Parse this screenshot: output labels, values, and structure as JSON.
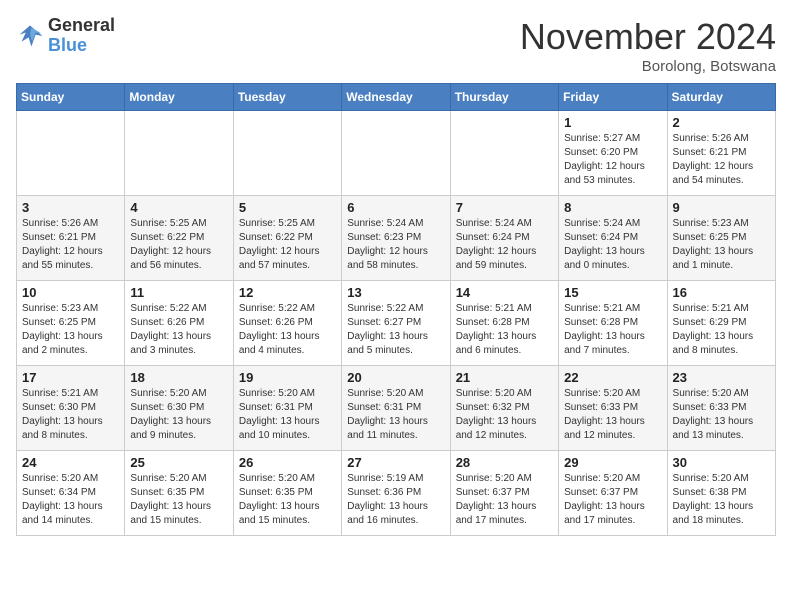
{
  "header": {
    "logo_general": "General",
    "logo_blue": "Blue",
    "month_title": "November 2024",
    "location": "Borolong, Botswana"
  },
  "weekdays": [
    "Sunday",
    "Monday",
    "Tuesday",
    "Wednesday",
    "Thursday",
    "Friday",
    "Saturday"
  ],
  "weeks": [
    [
      {
        "day": "",
        "detail": ""
      },
      {
        "day": "",
        "detail": ""
      },
      {
        "day": "",
        "detail": ""
      },
      {
        "day": "",
        "detail": ""
      },
      {
        "day": "",
        "detail": ""
      },
      {
        "day": "1",
        "detail": "Sunrise: 5:27 AM\nSunset: 6:20 PM\nDaylight: 12 hours\nand 53 minutes."
      },
      {
        "day": "2",
        "detail": "Sunrise: 5:26 AM\nSunset: 6:21 PM\nDaylight: 12 hours\nand 54 minutes."
      }
    ],
    [
      {
        "day": "3",
        "detail": "Sunrise: 5:26 AM\nSunset: 6:21 PM\nDaylight: 12 hours\nand 55 minutes."
      },
      {
        "day": "4",
        "detail": "Sunrise: 5:25 AM\nSunset: 6:22 PM\nDaylight: 12 hours\nand 56 minutes."
      },
      {
        "day": "5",
        "detail": "Sunrise: 5:25 AM\nSunset: 6:22 PM\nDaylight: 12 hours\nand 57 minutes."
      },
      {
        "day": "6",
        "detail": "Sunrise: 5:24 AM\nSunset: 6:23 PM\nDaylight: 12 hours\nand 58 minutes."
      },
      {
        "day": "7",
        "detail": "Sunrise: 5:24 AM\nSunset: 6:24 PM\nDaylight: 12 hours\nand 59 minutes."
      },
      {
        "day": "8",
        "detail": "Sunrise: 5:24 AM\nSunset: 6:24 PM\nDaylight: 13 hours\nand 0 minutes."
      },
      {
        "day": "9",
        "detail": "Sunrise: 5:23 AM\nSunset: 6:25 PM\nDaylight: 13 hours\nand 1 minute."
      }
    ],
    [
      {
        "day": "10",
        "detail": "Sunrise: 5:23 AM\nSunset: 6:25 PM\nDaylight: 13 hours\nand 2 minutes."
      },
      {
        "day": "11",
        "detail": "Sunrise: 5:22 AM\nSunset: 6:26 PM\nDaylight: 13 hours\nand 3 minutes."
      },
      {
        "day": "12",
        "detail": "Sunrise: 5:22 AM\nSunset: 6:26 PM\nDaylight: 13 hours\nand 4 minutes."
      },
      {
        "day": "13",
        "detail": "Sunrise: 5:22 AM\nSunset: 6:27 PM\nDaylight: 13 hours\nand 5 minutes."
      },
      {
        "day": "14",
        "detail": "Sunrise: 5:21 AM\nSunset: 6:28 PM\nDaylight: 13 hours\nand 6 minutes."
      },
      {
        "day": "15",
        "detail": "Sunrise: 5:21 AM\nSunset: 6:28 PM\nDaylight: 13 hours\nand 7 minutes."
      },
      {
        "day": "16",
        "detail": "Sunrise: 5:21 AM\nSunset: 6:29 PM\nDaylight: 13 hours\nand 8 minutes."
      }
    ],
    [
      {
        "day": "17",
        "detail": "Sunrise: 5:21 AM\nSunset: 6:30 PM\nDaylight: 13 hours\nand 8 minutes."
      },
      {
        "day": "18",
        "detail": "Sunrise: 5:20 AM\nSunset: 6:30 PM\nDaylight: 13 hours\nand 9 minutes."
      },
      {
        "day": "19",
        "detail": "Sunrise: 5:20 AM\nSunset: 6:31 PM\nDaylight: 13 hours\nand 10 minutes."
      },
      {
        "day": "20",
        "detail": "Sunrise: 5:20 AM\nSunset: 6:31 PM\nDaylight: 13 hours\nand 11 minutes."
      },
      {
        "day": "21",
        "detail": "Sunrise: 5:20 AM\nSunset: 6:32 PM\nDaylight: 13 hours\nand 12 minutes."
      },
      {
        "day": "22",
        "detail": "Sunrise: 5:20 AM\nSunset: 6:33 PM\nDaylight: 13 hours\nand 12 minutes."
      },
      {
        "day": "23",
        "detail": "Sunrise: 5:20 AM\nSunset: 6:33 PM\nDaylight: 13 hours\nand 13 minutes."
      }
    ],
    [
      {
        "day": "24",
        "detail": "Sunrise: 5:20 AM\nSunset: 6:34 PM\nDaylight: 13 hours\nand 14 minutes."
      },
      {
        "day": "25",
        "detail": "Sunrise: 5:20 AM\nSunset: 6:35 PM\nDaylight: 13 hours\nand 15 minutes."
      },
      {
        "day": "26",
        "detail": "Sunrise: 5:20 AM\nSunset: 6:35 PM\nDaylight: 13 hours\nand 15 minutes."
      },
      {
        "day": "27",
        "detail": "Sunrise: 5:19 AM\nSunset: 6:36 PM\nDaylight: 13 hours\nand 16 minutes."
      },
      {
        "day": "28",
        "detail": "Sunrise: 5:20 AM\nSunset: 6:37 PM\nDaylight: 13 hours\nand 17 minutes."
      },
      {
        "day": "29",
        "detail": "Sunrise: 5:20 AM\nSunset: 6:37 PM\nDaylight: 13 hours\nand 17 minutes."
      },
      {
        "day": "30",
        "detail": "Sunrise: 5:20 AM\nSunset: 6:38 PM\nDaylight: 13 hours\nand 18 minutes."
      }
    ]
  ]
}
